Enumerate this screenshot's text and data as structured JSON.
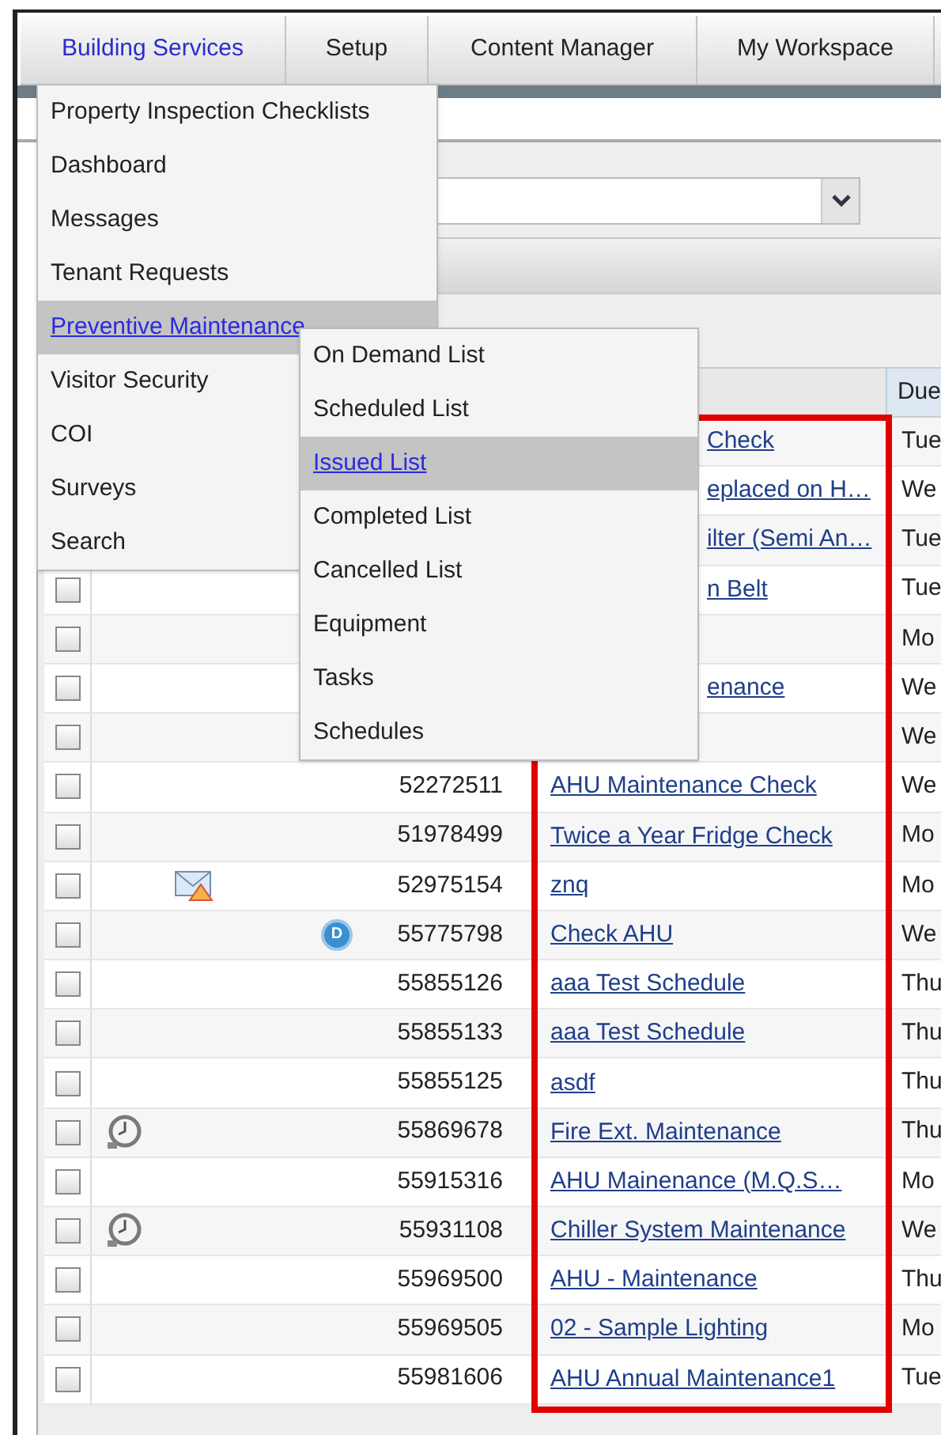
{
  "nav_tabs": [
    {
      "label": "Building Services",
      "selected": true
    },
    {
      "label": "Setup",
      "selected": false
    },
    {
      "label": "Content Manager",
      "selected": false
    },
    {
      "label": "My Workspace",
      "selected": false
    }
  ],
  "menu": {
    "items": [
      {
        "label": "Property Inspection Checklists",
        "selected": false
      },
      {
        "label": "Dashboard",
        "selected": false
      },
      {
        "label": "Messages",
        "selected": false
      },
      {
        "label": "Tenant Requests",
        "selected": false
      },
      {
        "label": "Preventive Maintenance",
        "selected": true
      },
      {
        "label": "Visitor Security",
        "selected": false
      },
      {
        "label": "COI",
        "selected": false
      },
      {
        "label": "Surveys",
        "selected": false
      },
      {
        "label": "Search",
        "selected": false
      }
    ]
  },
  "submenu": {
    "items": [
      {
        "label": "On Demand List",
        "selected": false
      },
      {
        "label": "Scheduled List",
        "selected": false
      },
      {
        "label": "Issued List",
        "selected": true
      },
      {
        "label": "Completed List",
        "selected": false
      },
      {
        "label": "Cancelled List",
        "selected": false
      },
      {
        "label": "Equipment",
        "selected": false
      },
      {
        "label": "Tasks",
        "selected": false
      },
      {
        "label": "Schedules",
        "selected": false
      }
    ]
  },
  "table": {
    "columns": [
      {
        "label": "Due"
      }
    ],
    "rows": [
      {
        "kind": "plain",
        "name": "Check",
        "due": "Tue"
      },
      {
        "kind": "plain",
        "name": "eplaced on H…",
        "due": "We"
      },
      {
        "kind": "plain",
        "name": "ilter (Semi An…",
        "due": "Tue"
      },
      {
        "kind": "plain",
        "name": "n Belt",
        "due": "Tue",
        "checked": false
      },
      {
        "kind": "plain",
        "due": "Mo",
        "checked": false
      },
      {
        "kind": "plain",
        "name": "enance",
        "due": "We",
        "checked": false
      },
      {
        "kind": "plain",
        "due": "We",
        "checked": false
      },
      {
        "kind": "plain",
        "id": "52272511",
        "name": "AHU Maintenance Check",
        "due": "We",
        "checked": false
      },
      {
        "kind": "plain",
        "id": "51978499",
        "name": "Twice a Year Fridge Check",
        "due": "Mo",
        "checked": false
      },
      {
        "kind": "mail-alert",
        "id": "52975154",
        "name": "znq",
        "due": "Mo",
        "checked": false
      },
      {
        "kind": "badge",
        "badge": "D",
        "id": "55775798",
        "name": "Check AHU",
        "due": "We",
        "checked": false
      },
      {
        "kind": "plain",
        "id": "55855126",
        "name": "aaa Test Schedule",
        "due": "Thu",
        "checked": false
      },
      {
        "kind": "plain",
        "id": "55855133",
        "name": "aaa Test Schedule",
        "due": "Thu",
        "checked": false
      },
      {
        "kind": "plain",
        "id": "55855125",
        "name": "asdf",
        "due": "Thu",
        "checked": false
      },
      {
        "kind": "clock",
        "id": "55869678",
        "name": "Fire Ext. Maintenance",
        "due": "Thu",
        "checked": false
      },
      {
        "kind": "plain",
        "id": "55915316",
        "name": "AHU Mainenance (M.Q.S…",
        "due": "Mo",
        "checked": false
      },
      {
        "kind": "clock",
        "id": "55931108",
        "name": "Chiller System Maintenance",
        "due": "We",
        "checked": false
      },
      {
        "kind": "plain",
        "id": "55969500",
        "name": "AHU - Maintenance",
        "due": "Thu",
        "checked": false
      },
      {
        "kind": "plain",
        "id": "55969505",
        "name": "02 - Sample Lighting",
        "due": "Mo",
        "checked": false
      },
      {
        "kind": "plain",
        "id": "55981606",
        "name": "AHU Annual Maintenance1",
        "due": "Tue",
        "checked": false
      }
    ]
  }
}
